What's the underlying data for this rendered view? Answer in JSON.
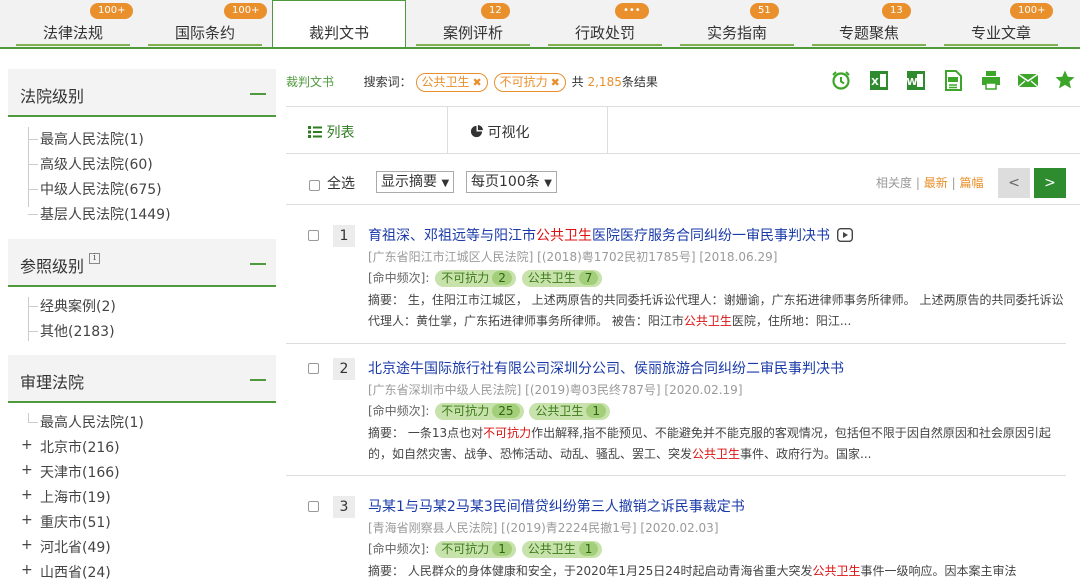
{
  "nav": {
    "tabs": [
      {
        "label": "法律法规",
        "badge": "100+"
      },
      {
        "label": "国际条约",
        "badge": "100+"
      },
      {
        "label": "裁判文书",
        "badge": ""
      },
      {
        "label": "案例评析",
        "badge": "12"
      },
      {
        "label": "行政处罚",
        "badge": "•••"
      },
      {
        "label": "实务指南",
        "badge": "51"
      },
      {
        "label": "专题聚焦",
        "badge": "13"
      },
      {
        "label": "专业文章",
        "badge": "100+"
      }
    ],
    "active": "裁判文书"
  },
  "sidebar": {
    "court_level": {
      "title": "法院级别",
      "items": [
        "最高人民法院(1)",
        "高级人民法院(60)",
        "中级人民法院(675)",
        "基层人民法院(1449)"
      ]
    },
    "ref_level": {
      "title": "参照级别",
      "info": "i",
      "items": [
        "经典案例(2)",
        "其他(2183)"
      ]
    },
    "trial_court": {
      "title": "审理法院",
      "items": [
        "最高人民法院(1)",
        "北京市(216)",
        "天津市(166)",
        "上海市(19)",
        "重庆市(51)",
        "河北省(49)",
        "山西省(24)"
      ]
    }
  },
  "search": {
    "breadcrumb": "裁判文书",
    "keywords_label": "搜索词：",
    "keywords": [
      "公共卫生",
      "不可抗力"
    ],
    "remove_glyph": "✖",
    "total_prefix": "共",
    "total": "2,185",
    "total_suffix": "条结果"
  },
  "toolbar_icons": [
    "alarm-clock-icon",
    "excel-icon",
    "word-icon",
    "pdf-icon",
    "print-icon",
    "mail-icon",
    "star-icon"
  ],
  "view_tabs": [
    "列表",
    "可视化"
  ],
  "list_tools": {
    "select_all": "全选",
    "display": "显示摘要",
    "per_page": "每页100条",
    "sort": [
      "相关度",
      "最新",
      "篇幅"
    ],
    "sort_sep": "|",
    "prev": "<",
    "next": ">"
  },
  "results": [
    {
      "num": "1",
      "title_parts": [
        "育祖深、邓祖远等与阳江市",
        "公共卫生",
        "医院医疗服务合同纠纷一审民事判决书"
      ],
      "meta": "[广东省阳江市江城区人民法院] [(2018)粤1702民初1785号] [2018.06.29]",
      "hits_label": "[命中频次]:",
      "hits": [
        {
          "k": "不可抗力",
          "n": "2"
        },
        {
          "k": "公共卫生",
          "n": "7"
        }
      ],
      "abstract_parts": [
        "摘要：  生，住阳江市江城区，  上述两原告的共同委托诉讼代理人：谢姗谕，广东拓进律师事务所律师。  上述两原告的共同委托诉讼代理人：黄仕掌，广东拓进律师事务所律师。  被告：阳江市",
        "公共卫生",
        "医院，住所地：阳江..."
      ]
    },
    {
      "num": "2",
      "title_parts": [
        "北京途牛国际旅行社有限公司深圳分公司、侯丽旅游合同纠纷二审民事判决书",
        "",
        ""
      ],
      "meta": "[广东省深圳市中级人民法院] [(2019)粤03民终787号] [2020.02.19]",
      "hits_label": "[命中频次]:",
      "hits": [
        {
          "k": "不可抗力",
          "n": "25"
        },
        {
          "k": "公共卫生",
          "n": "1"
        }
      ],
      "abstract_parts": [
        "摘要：  一条13点也对",
        "不可抗力",
        "作出解释,指不能预见、不能避免并不能克服的客观情况，包括但不限于因自然原因和社会原因引起的，如自然灾害、战争、恐怖活动、动乱、骚乱、罢工、突发",
        "公共卫生",
        "事件、政府行为。国家..."
      ]
    },
    {
      "num": "3",
      "title_parts": [
        "马某1与马某2马某3民间借贷纠纷第三人撤销之诉民事裁定书",
        "",
        ""
      ],
      "meta": "[青海省刚察县人民法院] [(2019)青2224民撤1号] [2020.02.03]",
      "hits_label": "[命中频次]:",
      "hits": [
        {
          "k": "不可抗力",
          "n": "1"
        },
        {
          "k": "公共卫生",
          "n": "1"
        }
      ],
      "abstract_parts": [
        "摘要：  人民群众的身体健康和安全，于2020年1月25日24时起启动青海省重大突发",
        "公共卫生",
        "事件一级响应。因本案主审法"
      ]
    }
  ]
}
